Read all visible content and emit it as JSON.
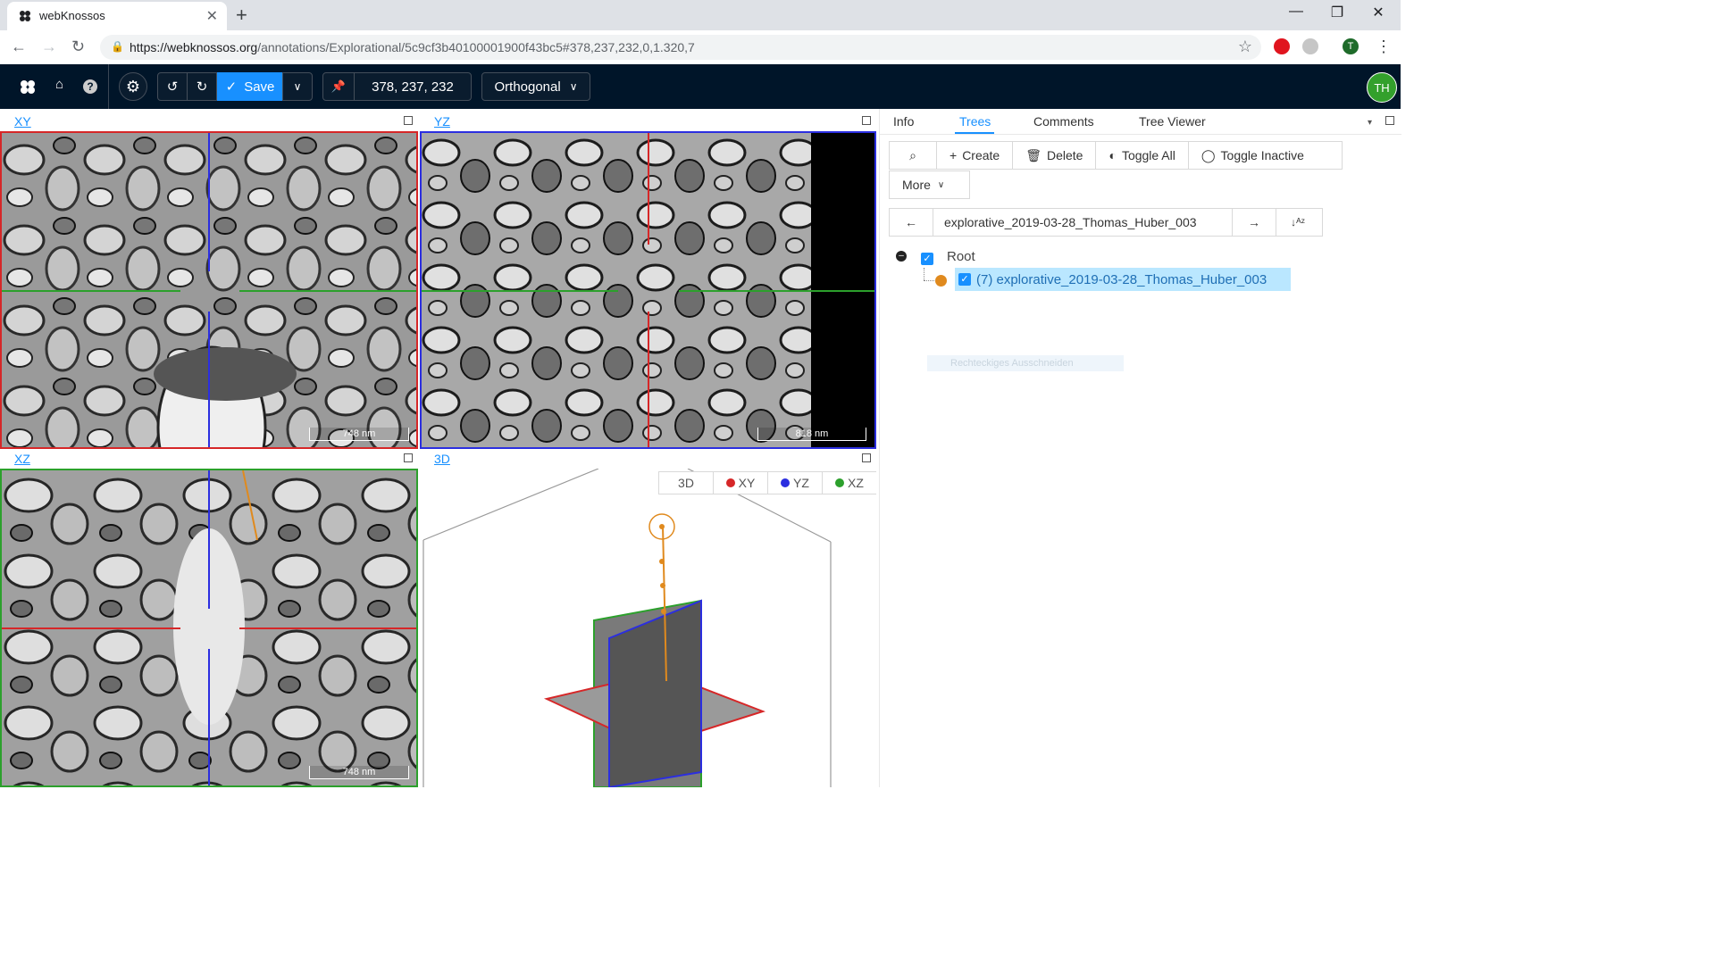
{
  "browser": {
    "tab_title": "webKnossos",
    "url_host": "https://webknossos.org",
    "url_path": "/annotations/Explorational/5c9cf3b40100001900f43bc5#378,237,232,0,1.320,7",
    "profile_initial": "T"
  },
  "toolbar": {
    "save_label": "Save",
    "position": "378, 237, 232",
    "view_mode": "Orthogonal",
    "user_initials": "TH"
  },
  "viewports": {
    "xy": {
      "label": "XY",
      "scale": "748 nm"
    },
    "yz": {
      "label": "YZ",
      "scale": "818 nm"
    },
    "xz": {
      "label": "XZ",
      "scale": "748 nm"
    },
    "td": {
      "label": "3D"
    }
  },
  "td_buttons": [
    "3D",
    "XY",
    "YZ",
    "XZ"
  ],
  "plane_colors": {
    "xy": "#d62728",
    "yz": "#2b2ee0",
    "xz": "#2ca02c"
  },
  "right_panel": {
    "tabs": [
      "Info",
      "Trees",
      "Comments",
      "Tree Viewer"
    ],
    "active_tab": "Trees",
    "buttons": {
      "create": "Create",
      "delete": "Delete",
      "toggle_all": "Toggle All",
      "toggle_inactive": "Toggle Inactive",
      "more": "More"
    },
    "active_tree": "explorative_2019-03-28_Thomas_Huber_003",
    "tree": {
      "root": "Root",
      "item": "(7) explorative_2019-03-28_Thomas_Huber_003"
    },
    "ghost_text": "Rechteckiges Ausschneiden"
  },
  "icons": [
    "clover-logo-icon",
    "home-icon",
    "help-icon",
    "settings-icon",
    "undo-icon",
    "redo-icon",
    "check-icon",
    "chevron-down-icon",
    "pin-icon",
    "search-icon",
    "plus-icon",
    "trash-icon",
    "toggle-icon",
    "arrow-left-icon",
    "arrow-right-icon",
    "sort-alpha-icon",
    "maximize-icon"
  ]
}
